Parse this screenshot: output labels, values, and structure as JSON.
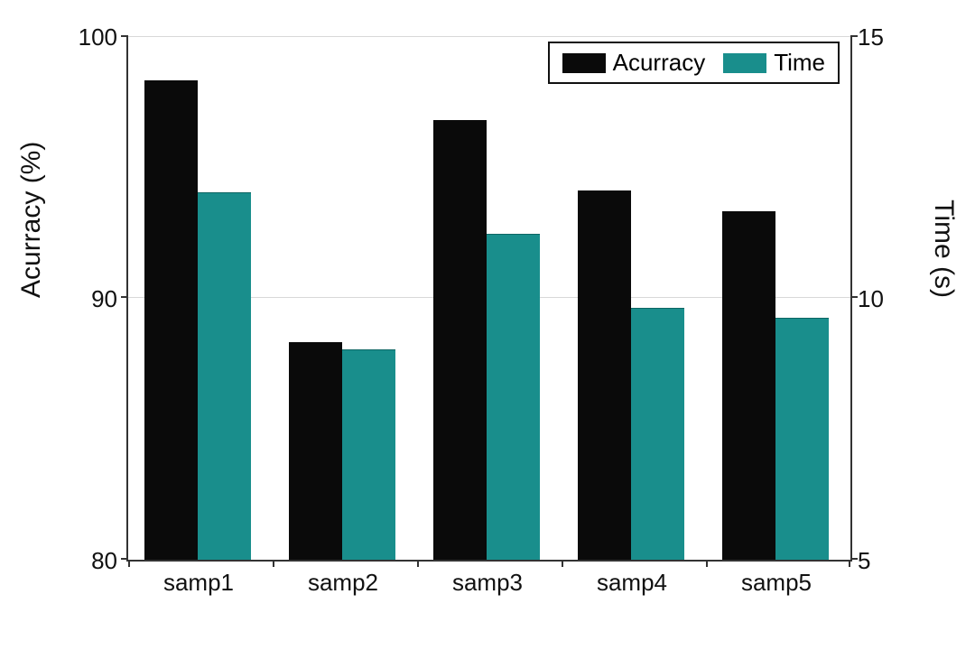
{
  "chart_data": {
    "type": "bar",
    "categories": [
      "samp1",
      "samp2",
      "samp3",
      "samp4",
      "samp5"
    ],
    "series": [
      {
        "name": "Acurracy",
        "axis": "left",
        "color": "#0a0a0a",
        "values": [
          98.3,
          88.3,
          96.8,
          94.1,
          93.3
        ]
      },
      {
        "name": "Time",
        "axis": "right",
        "color": "#198e8c",
        "values": [
          12.0,
          9.0,
          11.2,
          9.8,
          9.6
        ]
      }
    ],
    "left_axis": {
      "label": "Acurracy (%)",
      "min": 80,
      "max": 100,
      "ticks": [
        80,
        90,
        100
      ]
    },
    "right_axis": {
      "label": "Time (s)",
      "min": 5,
      "max": 15,
      "ticks": [
        5,
        10,
        15
      ]
    },
    "legend_position": "top-right",
    "grid": true
  },
  "legend": {
    "items": [
      {
        "label": "Acurracy"
      },
      {
        "label": "Time"
      }
    ]
  },
  "axes": {
    "left_label": "Acurracy (%)",
    "right_label": "Time (s)",
    "left_ticks": [
      "80",
      "90",
      "100"
    ],
    "right_ticks": [
      "5",
      "10",
      "15"
    ],
    "x_ticks": [
      "samp1",
      "samp2",
      "samp3",
      "samp4",
      "samp5"
    ]
  }
}
